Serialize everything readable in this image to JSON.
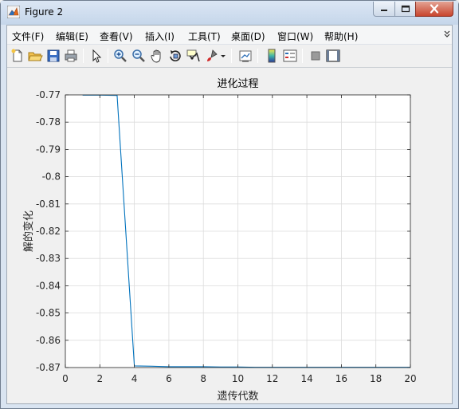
{
  "window": {
    "title": "Figure 2"
  },
  "menubar": {
    "items": [
      {
        "label": "文件(F)",
        "name": "menu-file"
      },
      {
        "label": "编辑(E)",
        "name": "menu-edit"
      },
      {
        "label": "查看(V)",
        "name": "menu-view"
      },
      {
        "label": "插入(I)",
        "name": "menu-insert"
      },
      {
        "label": "工具(T)",
        "name": "menu-tools"
      },
      {
        "label": "桌面(D)",
        "name": "menu-desktop"
      },
      {
        "label": "窗口(W)",
        "name": "menu-window"
      },
      {
        "label": "帮助(H)",
        "name": "menu-help"
      }
    ],
    "overflow_icon": "double-chevron-icon"
  },
  "toolbar": {
    "buttons": [
      {
        "icon": "new-figure-icon"
      },
      {
        "icon": "open-folder-icon"
      },
      {
        "icon": "save-icon"
      },
      {
        "icon": "print-icon"
      },
      {
        "icon": "pointer-icon"
      },
      {
        "icon": "zoom-in-icon"
      },
      {
        "icon": "zoom-out-icon"
      },
      {
        "icon": "pan-hand-icon"
      },
      {
        "icon": "rotate-3d-icon"
      },
      {
        "icon": "data-cursor-icon"
      },
      {
        "icon": "brush-icon"
      },
      {
        "icon": "link-plot-icon"
      },
      {
        "icon": "colorbar-icon"
      },
      {
        "icon": "legend-icon"
      },
      {
        "icon": "hide-plot-tools-icon"
      },
      {
        "icon": "show-plot-tools-icon"
      }
    ]
  },
  "chart_data": {
    "type": "line",
    "title": "进化过程",
    "xlabel": "遗传代数",
    "ylabel": "解的变化",
    "xlim": [
      0,
      20
    ],
    "ylim": [
      -0.87,
      -0.77
    ],
    "xticks": [
      0,
      2,
      4,
      6,
      8,
      10,
      12,
      14,
      16,
      18,
      20
    ],
    "yticks": [
      -0.77,
      -0.78,
      -0.79,
      -0.8,
      -0.81,
      -0.82,
      -0.83,
      -0.84,
      -0.85,
      -0.86,
      -0.87
    ],
    "ytick_labels": [
      "-0.77",
      "-0.78",
      "-0.79",
      "-0.8",
      "-0.81",
      "-0.82",
      "-0.83",
      "-0.84",
      "-0.85",
      "-0.86",
      "-0.87"
    ],
    "grid": true,
    "series": [
      {
        "color": "#0072bd",
        "x": [
          1,
          2,
          3,
          4,
          5,
          6,
          7,
          8,
          9,
          10,
          11,
          12,
          13,
          14,
          15,
          16,
          17,
          18,
          19,
          20
        ],
        "y": [
          -0.7701,
          -0.7701,
          -0.7702,
          -0.8694,
          -0.8695,
          -0.8697,
          -0.8697,
          -0.8697,
          -0.8698,
          -0.8698,
          -0.8699,
          -0.8699,
          -0.8699,
          -0.8699,
          -0.8699,
          -0.8699,
          -0.8699,
          -0.8699,
          -0.8699,
          -0.8699
        ]
      }
    ]
  }
}
